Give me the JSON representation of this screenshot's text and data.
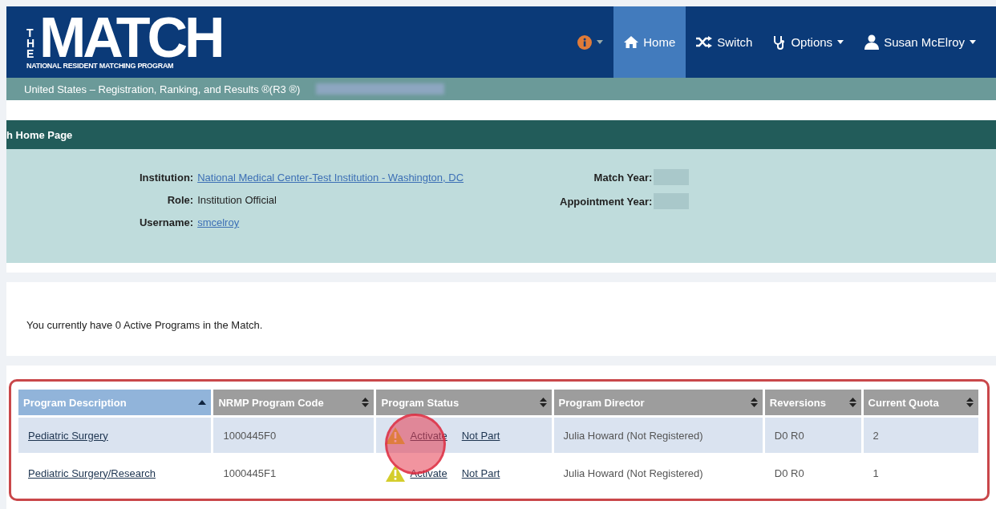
{
  "header": {
    "logo": {
      "the": "THE",
      "name": "MATCH",
      "subtitle": "NATIONAL RESIDENT MATCHING PROGRAM"
    },
    "nav": [
      {
        "kind": "info",
        "selected": false,
        "dropdown": true
      },
      {
        "kind": "home",
        "label": "Home",
        "selected": true,
        "dropdown": false
      },
      {
        "kind": "switch",
        "label": "Switch",
        "selected": false,
        "dropdown": false
      },
      {
        "kind": "options",
        "label": "Options",
        "selected": false,
        "dropdown": true
      },
      {
        "kind": "user",
        "label": "Susan McElroy",
        "selected": false,
        "dropdown": true
      }
    ]
  },
  "subbar": {
    "text": "United States  –  Registration, Ranking, and Results ®(R3 ®)"
  },
  "page_title": "h Home Page",
  "info": {
    "left": [
      {
        "label": "Institution:",
        "value": "National Medical Center-Test Institution - Washington, DC",
        "link": true
      },
      {
        "label": "Role:",
        "value": "Institution Official",
        "link": false
      },
      {
        "label": "Username:",
        "value": "smcelroy",
        "link": true
      }
    ],
    "right": [
      {
        "label": "Match Year:"
      },
      {
        "label": "Appointment Year:"
      }
    ]
  },
  "message": "You currently have 0 Active Programs in the Match.",
  "table": {
    "columns": [
      {
        "label": "Program Description",
        "sorted": true
      },
      {
        "label": "NRMP Program Code",
        "sorted": false
      },
      {
        "label": "Program Status",
        "sorted": false
      },
      {
        "label": "Program Director",
        "sorted": false
      },
      {
        "label": "Reversions",
        "sorted": false
      },
      {
        "label": "Current Quota",
        "sorted": false
      }
    ],
    "rows": [
      {
        "selected": true,
        "description": "Pediatric Surgery",
        "code": "1000445F0",
        "status_actions": [
          "Activate",
          "Not Part"
        ],
        "director": "Julia Howard (Not Registered)",
        "reversions": "D0 R0",
        "quota": "2"
      },
      {
        "selected": false,
        "description": "Pediatric Surgery/Research",
        "code": "1000445F1",
        "status_actions": [
          "Activate",
          "Not Part"
        ],
        "director": "Julia Howard (Not Registered)",
        "reversions": "D0 R0",
        "quota": "1"
      }
    ]
  }
}
